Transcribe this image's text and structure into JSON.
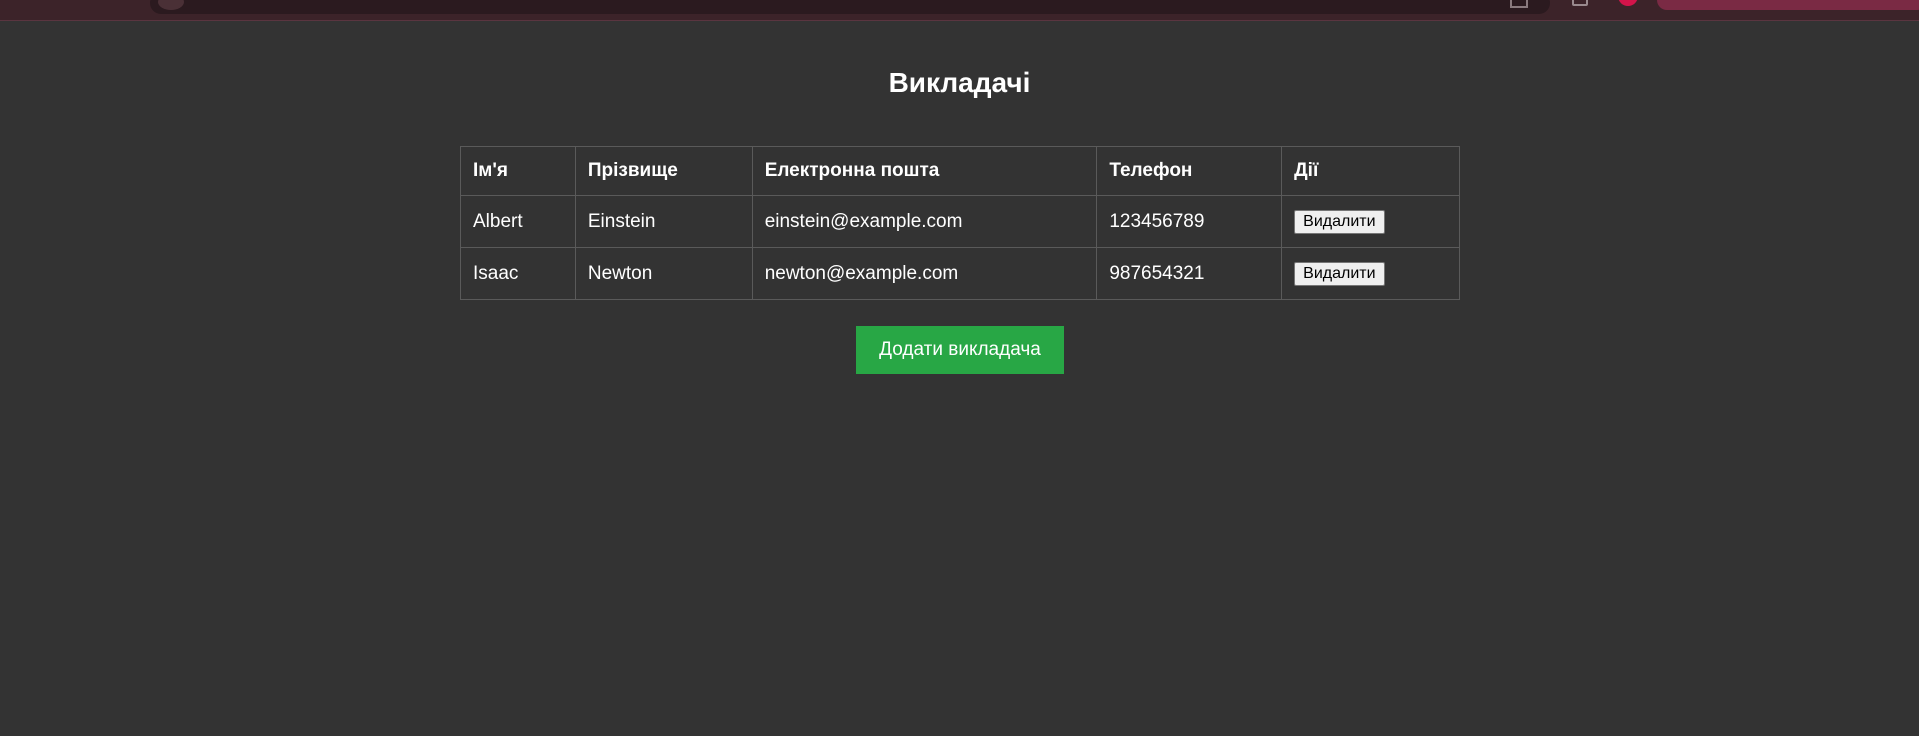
{
  "page": {
    "title": "Викладачі"
  },
  "table": {
    "headers": [
      "Ім'я",
      "Прізвище",
      "Електронна пошта",
      "Телефон",
      "Дії"
    ],
    "rows": [
      {
        "first_name": "Albert",
        "last_name": "Einstein",
        "email": "einstein@example.com",
        "phone": "123456789",
        "action_label": "Видалити"
      },
      {
        "first_name": "Isaac",
        "last_name": "Newton",
        "email": "newton@example.com",
        "phone": "987654321",
        "action_label": "Видалити"
      }
    ]
  },
  "actions": {
    "add_label": "Додати викладача"
  },
  "colors": {
    "background": "#333333",
    "add_button": "#28a745",
    "browser_accent": "#d2144a"
  }
}
